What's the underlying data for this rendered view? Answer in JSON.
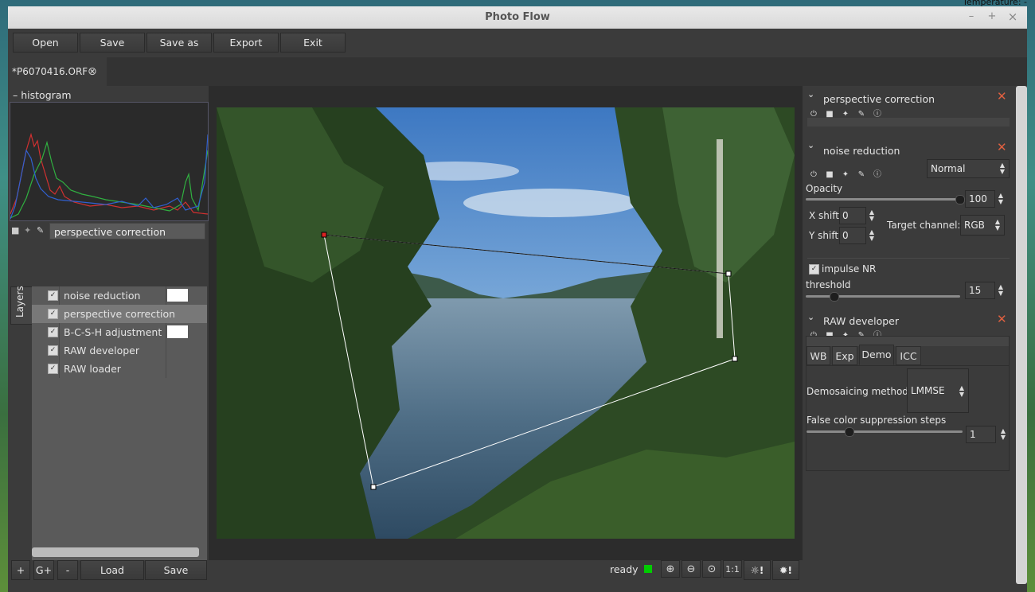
{
  "background_overlay_text": "Temperature: -",
  "window": {
    "title": "Photo Flow",
    "minimize": "–",
    "maximize": "+",
    "close": "×"
  },
  "toolbar": {
    "open": "Open",
    "save": "Save",
    "save_as": "Save as",
    "export": "Export",
    "exit": "Exit"
  },
  "tabs": [
    {
      "label": "*P6070416.ORF",
      "close": "⊗"
    }
  ],
  "histogram": {
    "title": "histogram",
    "collapse": "–"
  },
  "layer_name_field": "perspective correction",
  "layers_tab_label": "Layers",
  "layers": [
    {
      "label": "noise reduction",
      "checked": "✓",
      "has_mask": true
    },
    {
      "label": "perspective correction",
      "checked": "✓",
      "selected": true
    },
    {
      "label": "B-C-S-H adjustment",
      "checked": "✓",
      "has_mask": true
    },
    {
      "label": "RAW developer",
      "checked": "✓"
    },
    {
      "label": "RAW loader",
      "checked": "✓"
    }
  ],
  "layer_buttons": {
    "add": "+",
    "add_group": "G+",
    "remove": "-",
    "load": "Load",
    "save": "Save"
  },
  "status": {
    "text": "ready",
    "color": "#00cc00"
  },
  "view_buttons": {
    "zoom_in": "⊕",
    "zoom_out": "⊖",
    "zoom_fit": "⊙",
    "one_to_one": "1:1",
    "exclaim1": "!",
    "exclaim2": "!"
  },
  "panels": {
    "perspective": {
      "title": "perspective correction",
      "close": "✕"
    },
    "noise": {
      "title": "noise reduction",
      "close": "✕",
      "blend_mode": "Normal",
      "opacity_label": "Opacity",
      "opacity_value": "100",
      "opacity_fraction": 1.0,
      "xshift_label": "X shift",
      "xshift_value": "0",
      "yshift_label": "Y shift",
      "yshift_value": "0",
      "target_channel_label": "Target channel:",
      "target_channel_value": "RGB",
      "impulse_nr_label": "impulse NR",
      "threshold_label": "threshold",
      "threshold_value": "15",
      "threshold_fraction": 0.2
    },
    "raw": {
      "title": "RAW developer",
      "close": "✕",
      "tabs": [
        "WB",
        "Exp",
        "Demo",
        "ICC"
      ],
      "active_tab": "Demo",
      "demosaic_label": "Demosaicing method:",
      "demosaic_value": "LMMSE",
      "false_color_label": "False color suppression steps",
      "false_color_value": "1",
      "false_color_fraction": 0.25
    }
  },
  "colors": {
    "accent_close": "#e06040",
    "perspective_handle_active": "#dd2222"
  }
}
